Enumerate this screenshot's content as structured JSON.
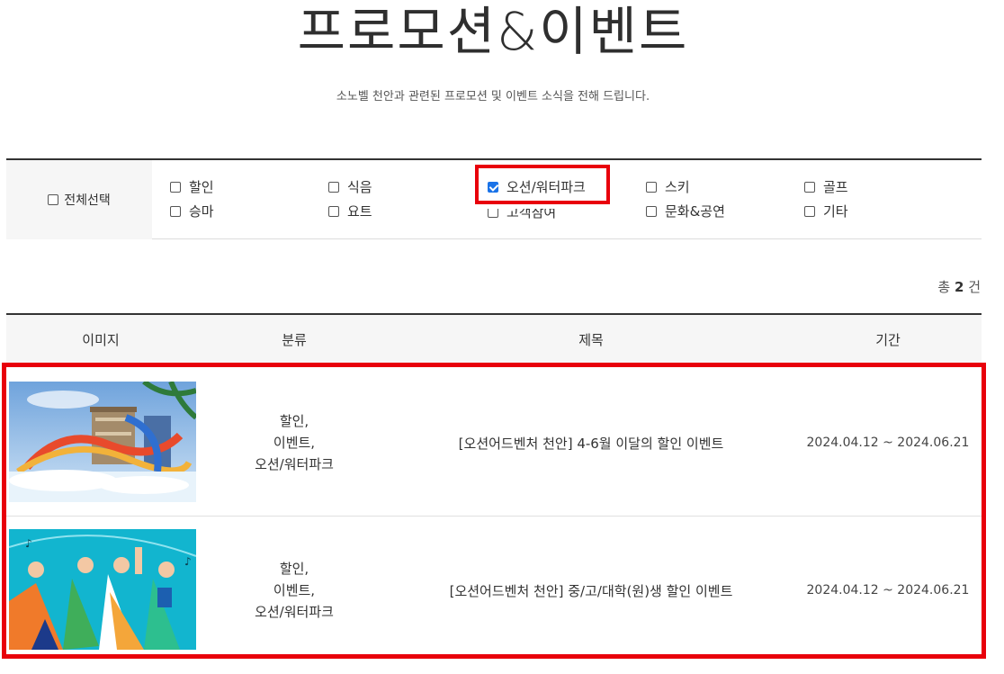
{
  "header": {
    "title": "프로모션&이벤트",
    "subtitle": "소노벨 천안과 관련된 프로모션 및 이벤트 소식을 전해 드립니다."
  },
  "filters": {
    "select_all": {
      "label": "전체선택",
      "checked": false
    },
    "options": [
      {
        "label": "할인",
        "checked": false
      },
      {
        "label": "식음",
        "checked": false
      },
      {
        "label": "오션/워터파크",
        "checked": true
      },
      {
        "label": "스키",
        "checked": false
      },
      {
        "label": "골프",
        "checked": false
      },
      {
        "label": "승마",
        "checked": false
      },
      {
        "label": "요트",
        "checked": false
      },
      {
        "label": "고객참여",
        "checked": false
      },
      {
        "label": "문화&공연",
        "checked": false
      },
      {
        "label": "기타",
        "checked": false
      }
    ]
  },
  "summary": {
    "prefix": "총",
    "count": "2",
    "suffix": "건"
  },
  "table": {
    "headers": [
      "이미지",
      "분류",
      "제목",
      "기간"
    ],
    "rows": [
      {
        "image": "waterpark-slides-photo",
        "categories": [
          "할인,",
          "이벤트,",
          "오션/워터파크"
        ],
        "title": "[오션어드벤처 천안] 4-6월 이달의 할인 이벤트",
        "period": "2024.04.12 ~ 2024.06.21"
      },
      {
        "image": "students-dancing-illustration",
        "categories": [
          "할인,",
          "이벤트,",
          "오션/워터파크"
        ],
        "title": "[오션어드벤처 천안] 중/고/대학(원)생 할인 이벤트",
        "period": "2024.04.12 ~ 2024.06.21"
      }
    ]
  },
  "colors": {
    "highlight": "#e8000b",
    "checkbox_checked": "#1a73e8",
    "header_bg": "#f6f6f6"
  }
}
